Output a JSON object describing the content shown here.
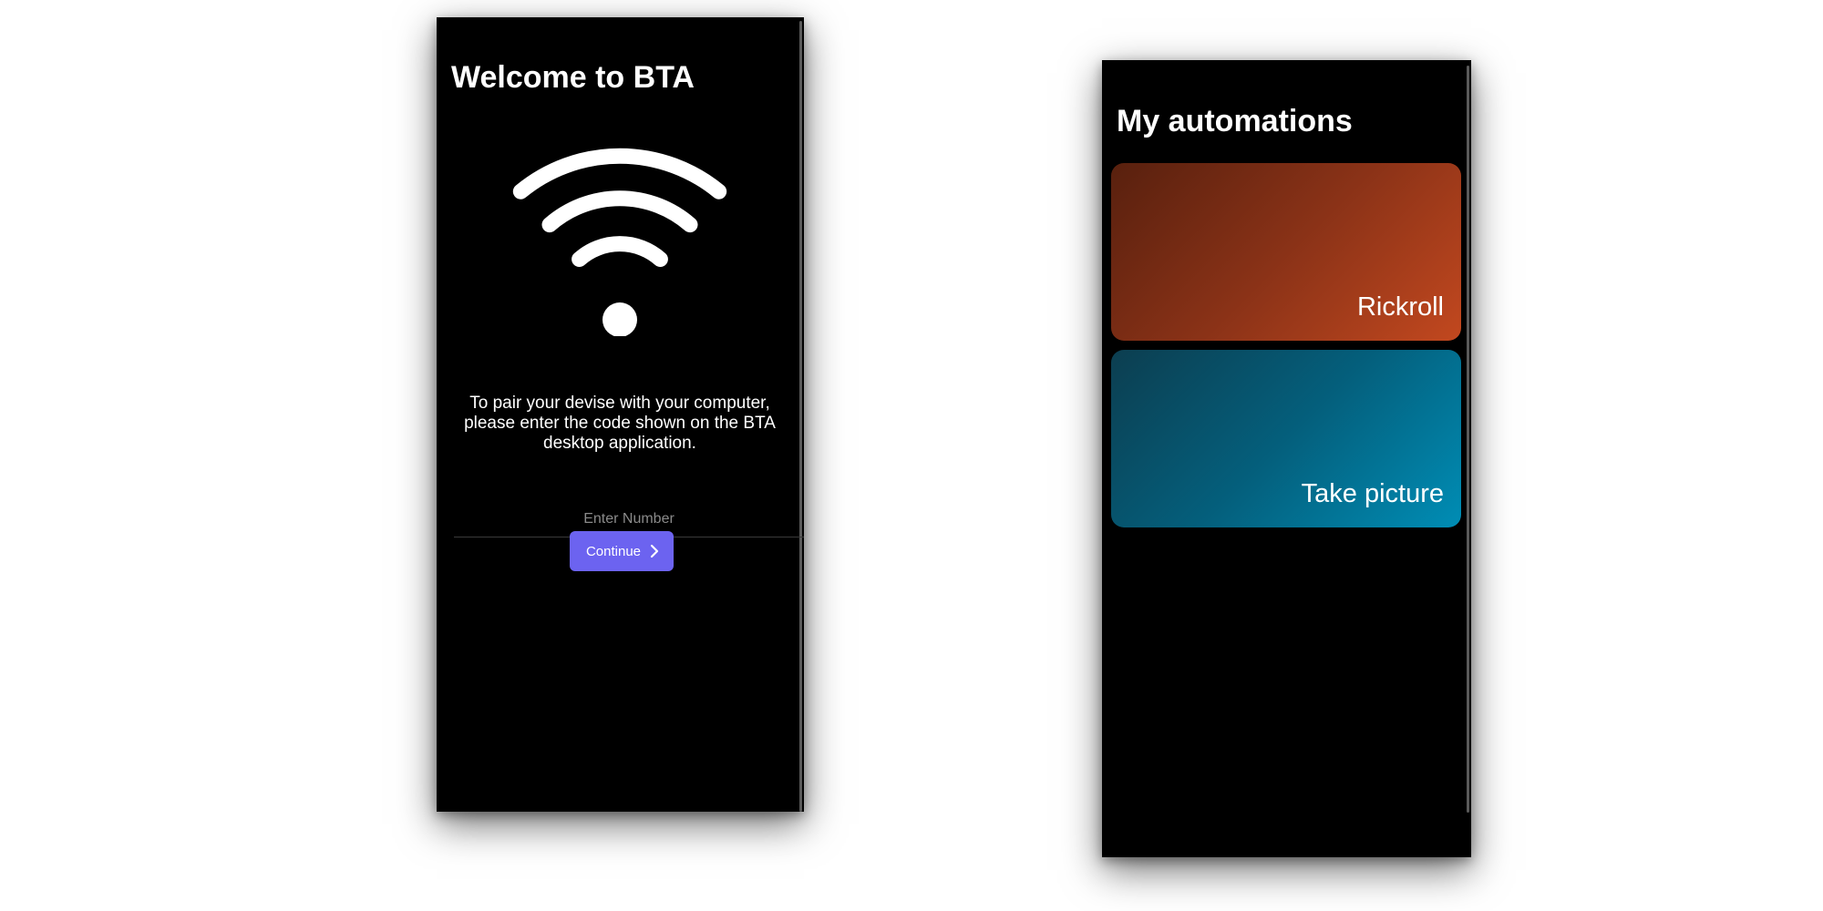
{
  "pairing_screen": {
    "title": "Welcome to BTA",
    "icon": "wifi-icon",
    "instructions": "To pair your devise with your computer, please enter the code shown on the BTA desktop application.",
    "number_input": {
      "placeholder": "Enter Number",
      "value": ""
    },
    "continue_button": {
      "label": "Continue",
      "icon": "chevron-right-icon",
      "color": "#6c63f0"
    }
  },
  "automations_screen": {
    "title": "My automations",
    "cards": [
      {
        "label": "Rickroll",
        "color_start": "#58200e",
        "color_end": "#c2481f"
      },
      {
        "label": "Take picture",
        "color_start": "#0c3e50",
        "color_end": "#008db5"
      }
    ]
  }
}
